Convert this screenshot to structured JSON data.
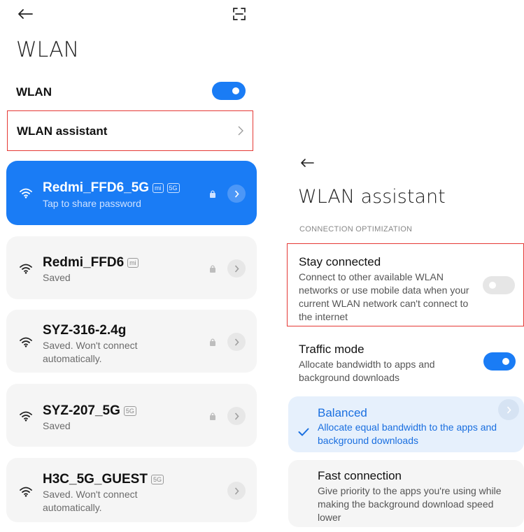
{
  "left": {
    "title": "WLAN",
    "wlan_row": {
      "label": "WLAN",
      "toggle_on": true
    },
    "assistant_row": {
      "label": "WLAN assistant"
    },
    "networks": [
      {
        "name": "Redmi_FFD6_5G",
        "badges": [
          "mi",
          "5G"
        ],
        "status": "Tap to share password",
        "locked": true,
        "active": true
      },
      {
        "name": "Redmi_FFD6",
        "badges": [
          "mi"
        ],
        "status": "Saved",
        "locked": true,
        "active": false
      },
      {
        "name": "SYZ-316-2.4g",
        "badges": [],
        "status": "Saved. Won't connect automatically.",
        "locked": true,
        "active": false
      },
      {
        "name": "SYZ-207_5G",
        "badges": [
          "5G"
        ],
        "status": "Saved",
        "locked": true,
        "active": false
      },
      {
        "name": "H3C_5G_GUEST",
        "badges": [
          "5G"
        ],
        "status": "Saved. Won't connect automatically.",
        "locked": false,
        "active": false
      }
    ]
  },
  "right": {
    "title": "WLAN assistant",
    "section_header": "CONNECTION OPTIMIZATION",
    "stay_connected": {
      "title": "Stay connected",
      "description": "Connect to other available WLAN networks or use mobile data when your current WLAN network can't connect to the internet",
      "toggle_on": false
    },
    "traffic_mode": {
      "title": "Traffic mode",
      "description": "Allocate bandwidth to apps and background downloads",
      "toggle_on": true
    },
    "options": [
      {
        "title": "Balanced",
        "description": "Allocate equal bandwidth to the apps and background downloads",
        "selected": true
      },
      {
        "title": "Fast connection",
        "description": "Give priority to the apps you're using while making the background download speed lower",
        "selected": false
      }
    ]
  },
  "colors": {
    "accent": "#1a7cf5",
    "highlight": "#e53935",
    "background": "#ffffff",
    "card": "#f5f5f5"
  }
}
